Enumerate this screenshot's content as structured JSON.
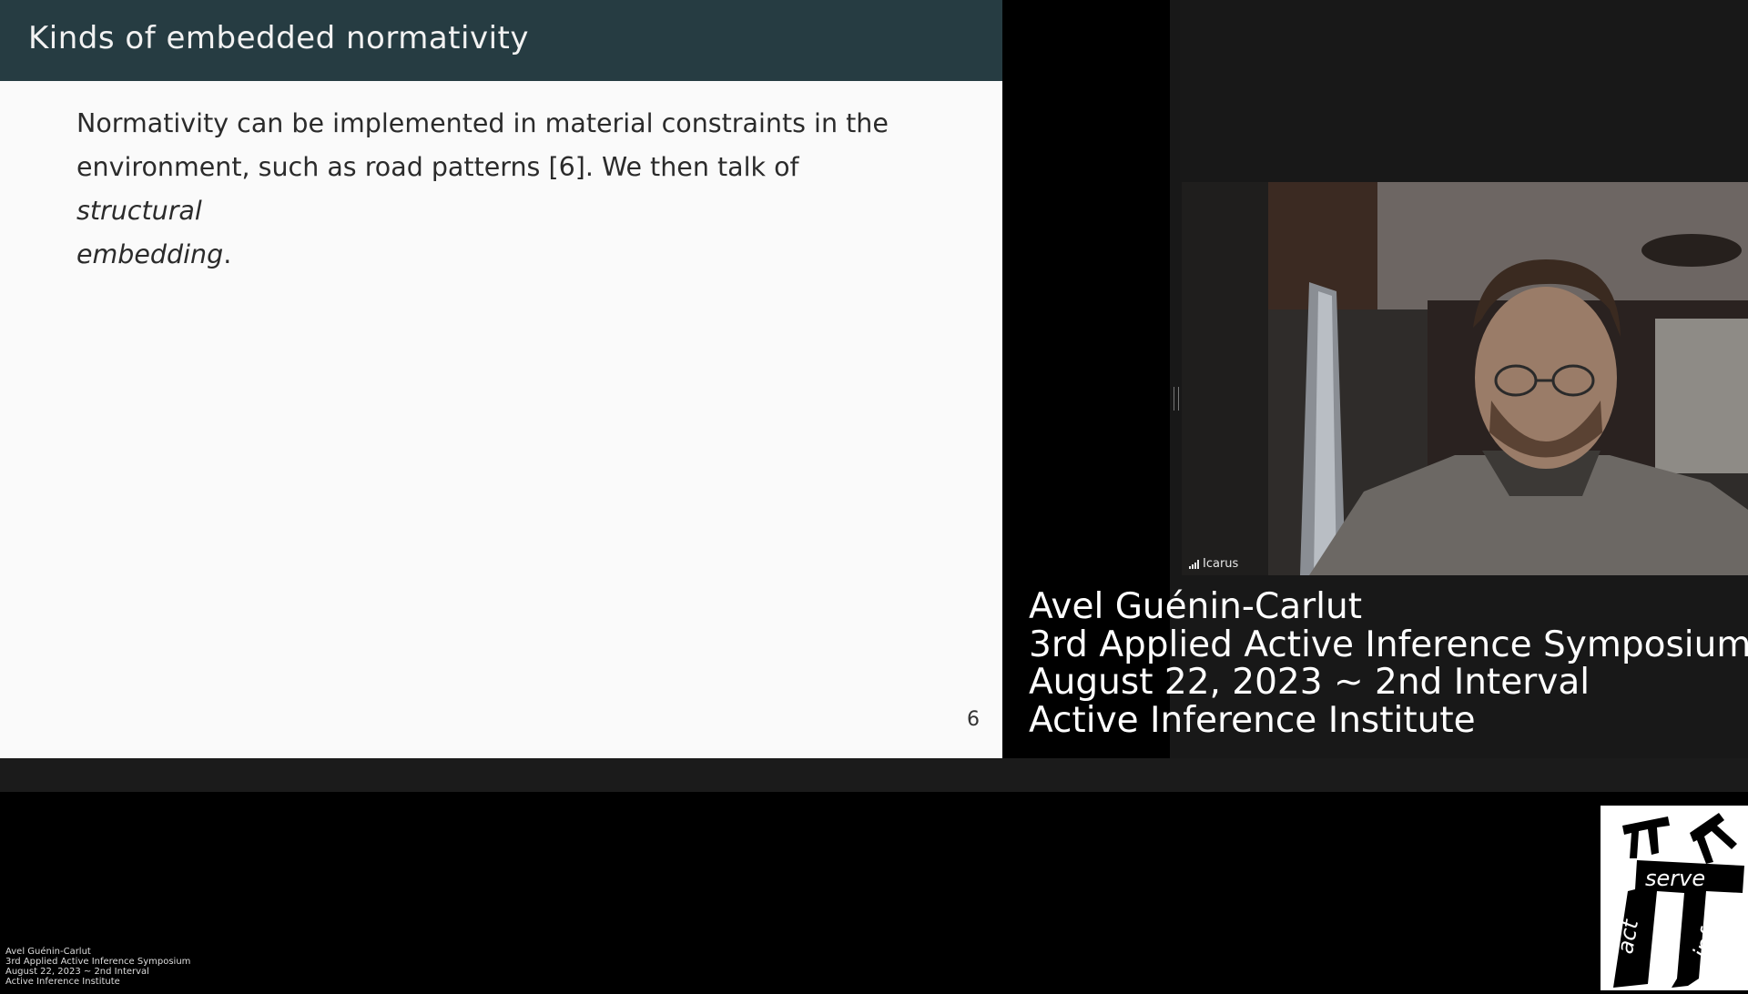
{
  "slide": {
    "title": "Kinds of embedded normativity",
    "body_line1": "Normativity can be implemented in material constraints in the",
    "body_line2": "environment, such as road patterns [6]. We then talk of ",
    "body_italic1": "structural",
    "body_italic2": "embedding",
    "body_end": ".",
    "page_number": "6"
  },
  "webcam": {
    "participant_name": "Icarus",
    "signal_icon": "signal-bars-icon"
  },
  "caption": {
    "speaker": "Avel Guénin-Carlut",
    "event": "3rd Applied Active Inference Symposium",
    "date": "August 22, 2023 ~ 2nd Interval",
    "organization": "Active Inference Institute"
  },
  "small_caption": {
    "speaker": "Avel Guénin-Carlut",
    "event": "3rd Applied Active Inference Symposium",
    "date": "August 22, 2023 ~ 2nd Interval",
    "organization": "Active Inference Institute"
  },
  "logo": {
    "word_top": "serve",
    "word_left": "act",
    "word_right": "infer",
    "icon": "pi-logo-icon"
  },
  "colors": {
    "slide_header": "#263c42",
    "slide_bg": "#fafafa",
    "stage_bg": "#000000",
    "panel_bg": "#181818"
  }
}
